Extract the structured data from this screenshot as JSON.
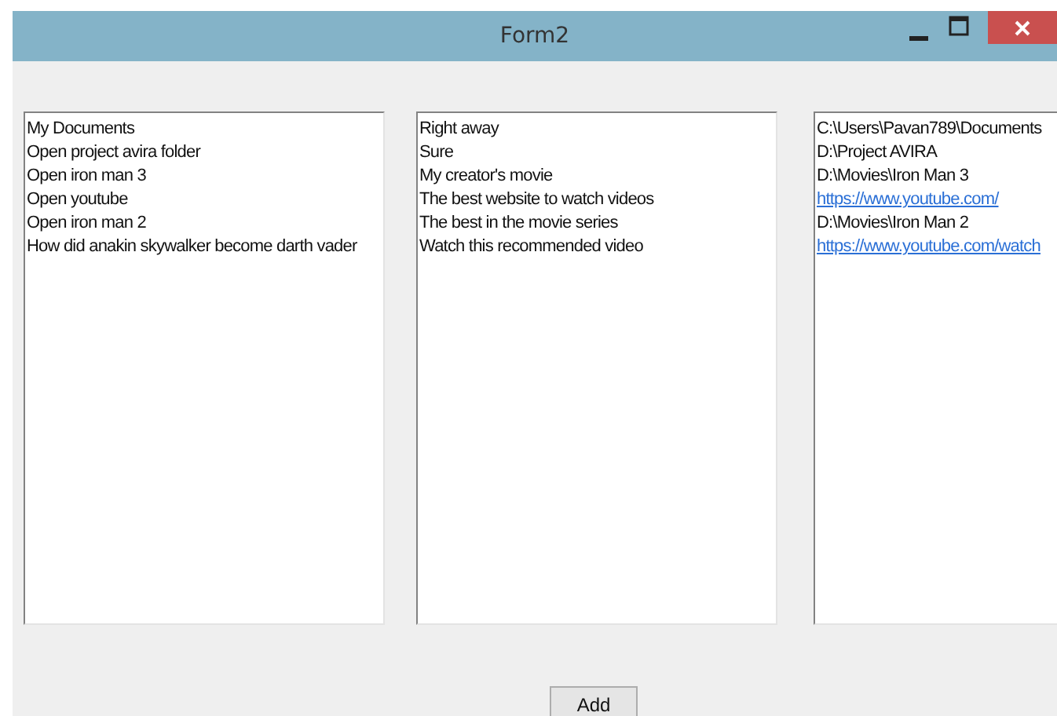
{
  "window": {
    "title": "Form2"
  },
  "lists": [
    {
      "items": [
        {
          "text": "My Documents",
          "kind": "text"
        },
        {
          "text": "Open project avira folder",
          "kind": "text"
        },
        {
          "text": "Open iron man 3",
          "kind": "text"
        },
        {
          "text": "Open youtube",
          "kind": "text"
        },
        {
          "text": "Open iron man 2",
          "kind": "text"
        },
        {
          "text": "How did anakin skywalker become darth vader",
          "kind": "text"
        }
      ]
    },
    {
      "items": [
        {
          "text": "Right away",
          "kind": "text"
        },
        {
          "text": "Sure",
          "kind": "text"
        },
        {
          "text": "My creator's movie",
          "kind": "text"
        },
        {
          "text": "The best website to watch videos",
          "kind": "text"
        },
        {
          "text": "The best in the movie series",
          "kind": "text"
        },
        {
          "text": "Watch this recommended video",
          "kind": "text"
        }
      ]
    },
    {
      "items": [
        {
          "text": "C:\\Users\\Pavan789\\Documents",
          "kind": "text"
        },
        {
          "text": "D:\\Project AVIRA",
          "kind": "text"
        },
        {
          "text": "D:\\Movies\\Iron Man 3",
          "kind": "text"
        },
        {
          "text": "https://www.youtube.com/",
          "kind": "link"
        },
        {
          "text": "D:\\Movies\\Iron Man 2",
          "kind": "text"
        },
        {
          "text": "https://www.youtube.com/watch",
          "kind": "link"
        }
      ]
    }
  ],
  "buttons": [
    "Add"
  ]
}
